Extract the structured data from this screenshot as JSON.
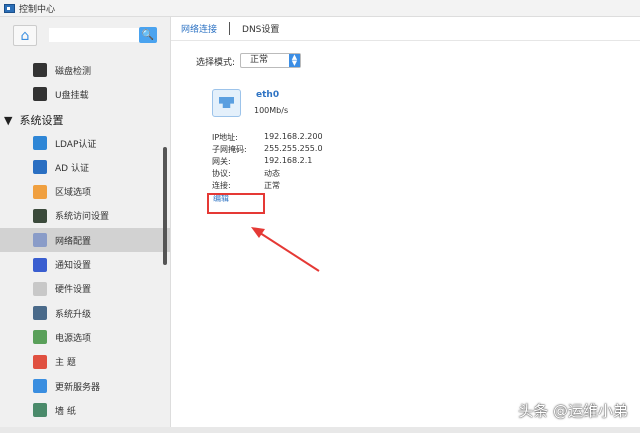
{
  "window": {
    "title": "控制中心"
  },
  "sidebar": {
    "search_placeholder": "",
    "items_top": [
      {
        "label": "磁盘检测",
        "color": "#333"
      },
      {
        "label": "U盘挂载",
        "color": "#333"
      }
    ],
    "group": "系统设置",
    "items": [
      {
        "label": "LDAP认证",
        "color": "#2e86d6"
      },
      {
        "label": "AD 认证",
        "color": "#2a6fc2"
      },
      {
        "label": "区域选项",
        "color": "#f0a040"
      },
      {
        "label": "系统访问设置",
        "color": "#3b4a3b"
      },
      {
        "label": "网络配置",
        "color": "#8a9cc8"
      },
      {
        "label": "通知设置",
        "color": "#3a5ed0"
      },
      {
        "label": "硬件设置",
        "color": "#c8c8c8"
      },
      {
        "label": "系统升级",
        "color": "#4a6a8a"
      },
      {
        "label": "电源选项",
        "color": "#5aa05a"
      },
      {
        "label": "主 题",
        "color": "#e05040"
      },
      {
        "label": "更新服务器",
        "color": "#3a8ee0"
      },
      {
        "label": "墙 纸",
        "color": "#4a8a6a"
      }
    ],
    "selected_index": 4
  },
  "tabs": [
    {
      "label": "网络连接",
      "active": true
    },
    {
      "label": "DNS设置",
      "active": false
    }
  ],
  "mode": {
    "label": "选择模式:",
    "value": "正常"
  },
  "interface": {
    "name": "eth0",
    "speed": "100Mb/s",
    "fields": [
      {
        "key": "IP地址:",
        "value": "192.168.2.200"
      },
      {
        "key": "子网掩码:",
        "value": "255.255.255.0"
      },
      {
        "key": "网关:",
        "value": "192.168.2.1"
      },
      {
        "key": "协议:",
        "value": "动态"
      },
      {
        "key": "连接:",
        "value": "正常"
      }
    ],
    "edit_label": "编辑"
  },
  "watermark": "头条 @运维小弟"
}
